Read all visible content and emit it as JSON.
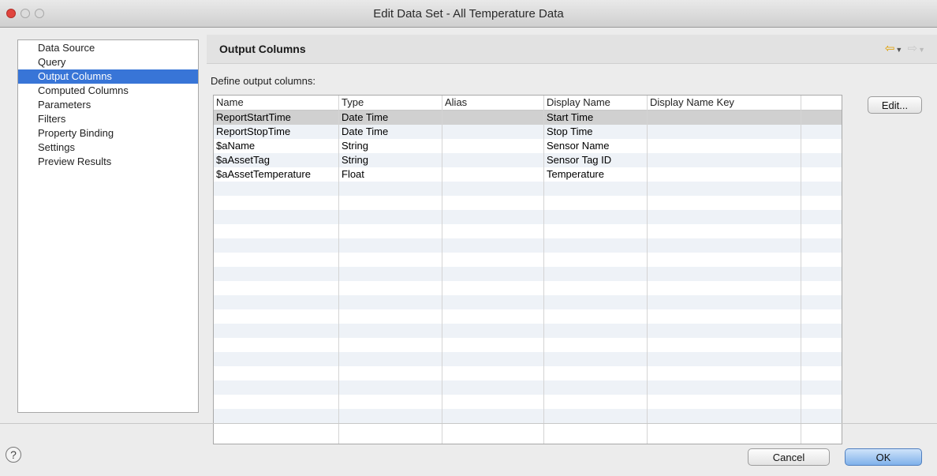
{
  "window": {
    "title": "Edit Data Set - All Temperature Data"
  },
  "nav": {
    "items": [
      {
        "label": "Data Source"
      },
      {
        "label": "Query"
      },
      {
        "label": "Output Columns",
        "selected": true
      },
      {
        "label": "Computed Columns"
      },
      {
        "label": "Parameters"
      },
      {
        "label": "Filters"
      },
      {
        "label": "Property Binding"
      },
      {
        "label": "Settings"
      },
      {
        "label": "Preview Results"
      }
    ]
  },
  "section": {
    "title": "Output Columns",
    "define_label": "Define output columns:",
    "back_icon": "back-arrow-icon",
    "forward_icon": "forward-arrow-icon"
  },
  "table": {
    "columns": [
      "Name",
      "Type",
      "Alias",
      "Display Name",
      "Display Name Key"
    ],
    "rows": [
      [
        "ReportStartTime",
        "Date Time",
        "",
        "Start Time",
        ""
      ],
      [
        "ReportStopTime",
        "Date Time",
        "",
        "Stop Time",
        ""
      ],
      [
        "$aName",
        "String",
        "",
        "Sensor Name",
        ""
      ],
      [
        "$aAssetTag",
        "String",
        "",
        "Sensor Tag ID",
        ""
      ],
      [
        "$aAssetTemperature",
        "Float",
        "",
        "Temperature",
        ""
      ]
    ],
    "selected_row": 0
  },
  "buttons": {
    "edit": "Edit...",
    "cancel": "Cancel",
    "ok": "OK",
    "help": "?"
  },
  "colors": {
    "selection": "#3875d7",
    "ok_button": "#7fb1ea",
    "close_button": "#e0443e"
  }
}
